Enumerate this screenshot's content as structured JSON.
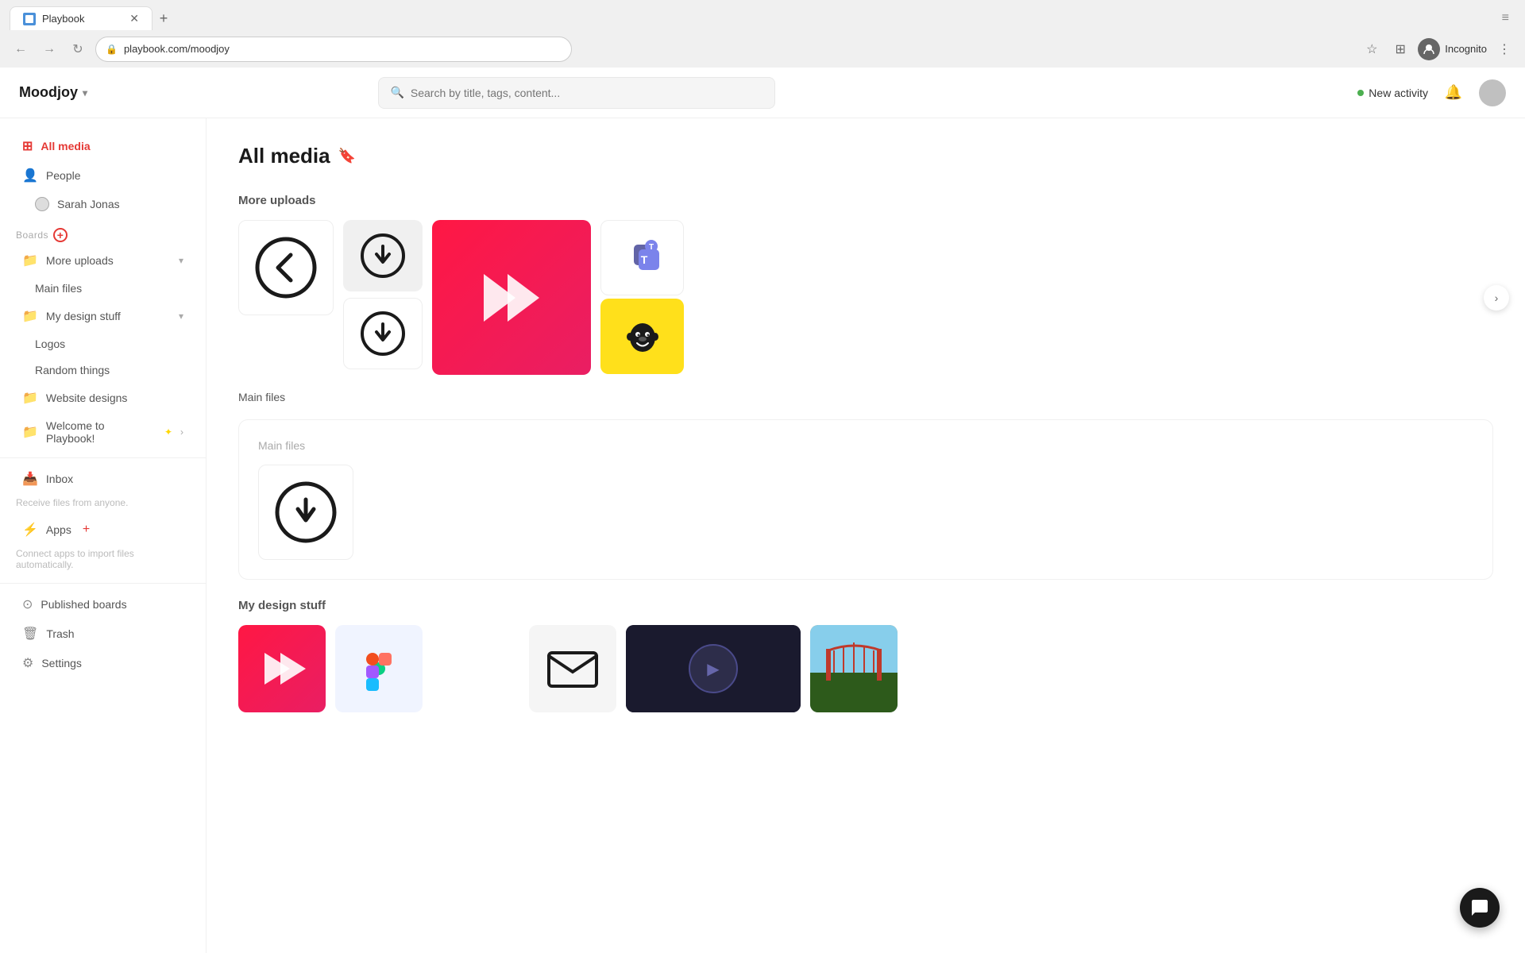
{
  "browser": {
    "tab_title": "Playbook",
    "tab_favicon": "📋",
    "url": "playbook.com/moodjoy",
    "nav_back": "←",
    "nav_forward": "→",
    "nav_reload": "↻",
    "incognito_label": "Incognito"
  },
  "header": {
    "brand_name": "Moodjoy",
    "brand_chevron": "▾",
    "search_placeholder": "Search by title, tags, content...",
    "new_activity_label": "New activity",
    "notification_icon": "🔔",
    "avatar_label": "User avatar"
  },
  "sidebar": {
    "all_media_label": "All media",
    "people_label": "People",
    "sarah_jonas_label": "Sarah Jonas",
    "boards_label": "Boards",
    "more_uploads_label": "More uploads",
    "main_files_label": "Main files",
    "my_design_stuff_label": "My design stuff",
    "logos_label": "Logos",
    "random_things_label": "Random things",
    "website_designs_label": "Website designs",
    "welcome_label": "Welcome to Playbook!",
    "inbox_label": "Inbox",
    "inbox_hint": "Receive files from anyone.",
    "apps_label": "Apps",
    "apps_hint": "Connect apps to import files automatically.",
    "published_boards_label": "Published boards",
    "trash_label": "Trash",
    "settings_label": "Settings"
  },
  "content": {
    "page_title": "All media",
    "more_uploads_section": "More uploads",
    "main_files_section": "Main files",
    "main_files_subsection": "Main files",
    "my_design_stuff_section": "My design stuff"
  },
  "colors": {
    "active_red": "#e53935",
    "play_gradient_start": "#ff1744",
    "play_gradient_end": "#e91e63",
    "mailchimp_yellow": "#FFE01B",
    "teams_blue": "#6264A7",
    "star_gold": "#FFD700",
    "activity_green": "#4CAF50"
  }
}
